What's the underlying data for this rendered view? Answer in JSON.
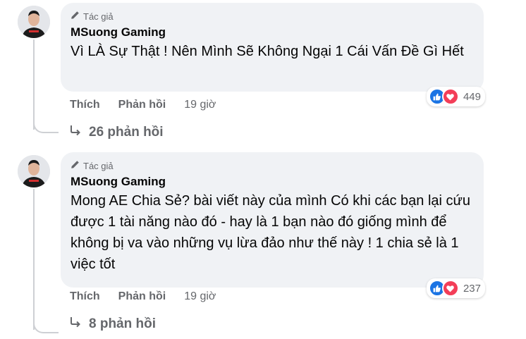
{
  "comments": [
    {
      "badge": "Tác giả",
      "author": "MSuong Gaming",
      "text": "Vì LÀ Sự Thật ! Nên Mình Sẽ Không Ngại 1 Cái Vấn Đề Gì Hết",
      "reaction_count": "449",
      "like_label": "Thích",
      "reply_label": "Phản hồi",
      "time": "19 giờ",
      "replies_label": "26 phản hồi"
    },
    {
      "badge": "Tác giả",
      "author": "MSuong Gaming",
      "text": "Mong AE Chia Sẻ? bài viết này của mình Có khi các bạn lại cứu được 1 tài năng nào đó - hay là 1 bạn nào đó giống mình để không bị va vào những vụ lừa đảo như thế này ! 1 chia sẻ là 1 việc tốt",
      "reaction_count": "237",
      "like_label": "Thích",
      "reply_label": "Phản hồi",
      "time": "19 giờ",
      "replies_label": "8 phản hồi"
    }
  ],
  "colors": {
    "bubble": "#f0f2f5",
    "secondary_text": "#65676b",
    "like": "#1b74e4",
    "love": "#f33e58"
  },
  "icons": [
    "pen-icon",
    "like-icon",
    "love-icon",
    "reply-arrow-icon",
    "avatar"
  ]
}
